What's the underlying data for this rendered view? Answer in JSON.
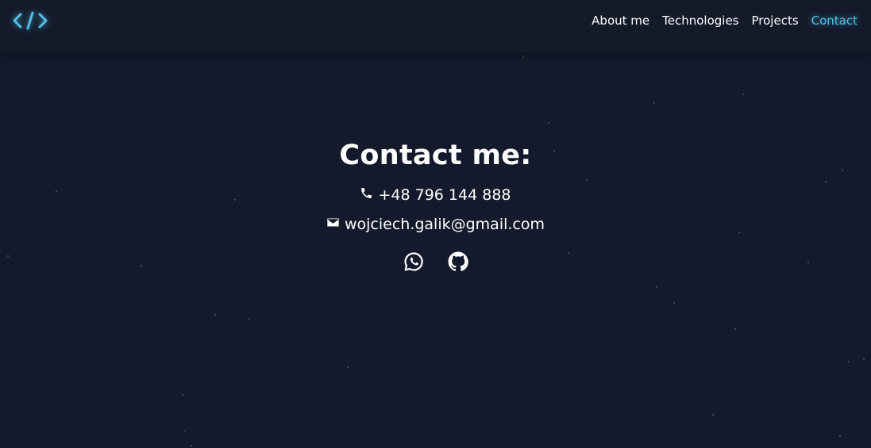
{
  "nav": {
    "logo_icon": "code-brackets-icon",
    "links": [
      {
        "label": "About me"
      },
      {
        "label": "Technologies"
      },
      {
        "label": "Projects"
      },
      {
        "label": "Contact"
      }
    ],
    "active_index": 3
  },
  "contact": {
    "title": "Contact me:",
    "phone": {
      "icon": "phone-icon",
      "text": "+48 796 144 888"
    },
    "email": {
      "icon": "envelope-icon",
      "text": "wojciech.galik@gmail.com"
    },
    "social": [
      {
        "icon": "whatsapp-icon"
      },
      {
        "icon": "github-icon"
      }
    ]
  },
  "colors": {
    "background": "#141a2b",
    "accent": "#56bfe6",
    "text": "#ffffff",
    "star": "#4a7a8c"
  }
}
